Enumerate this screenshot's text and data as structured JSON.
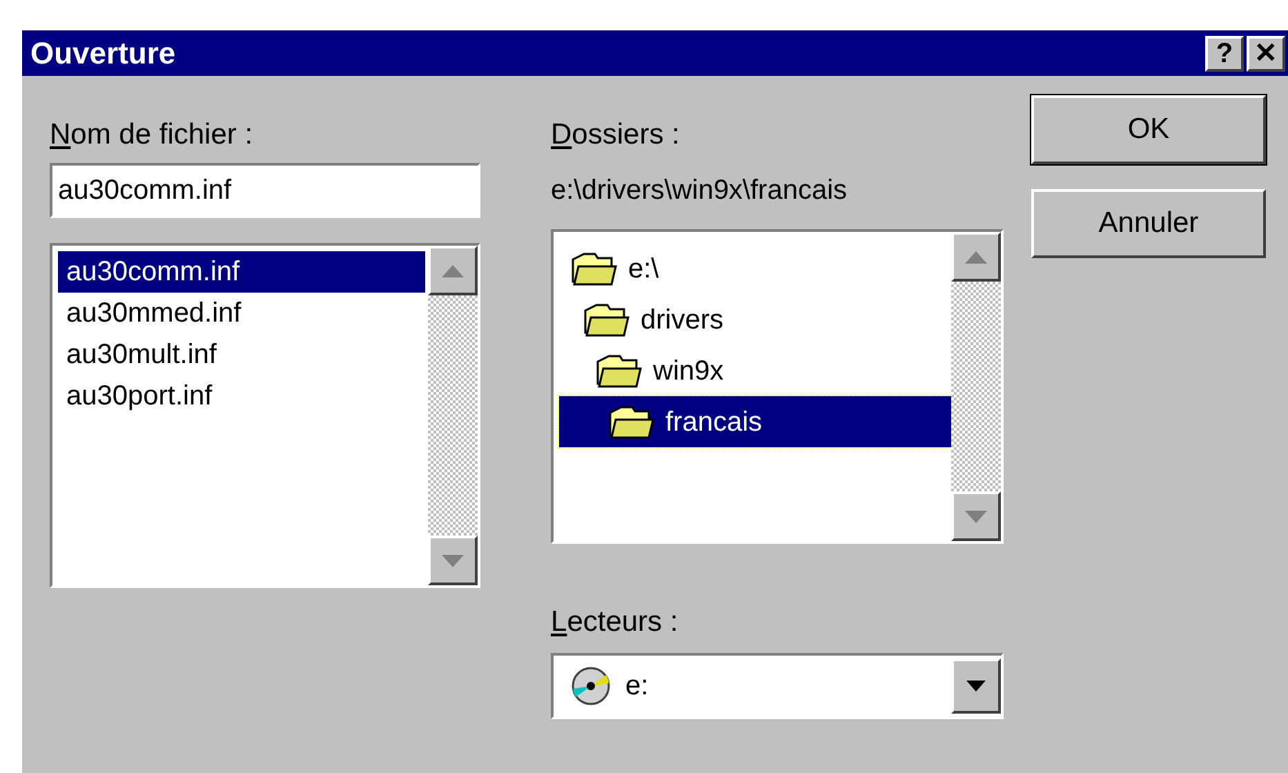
{
  "window": {
    "title": "Ouverture",
    "controls": [
      {
        "label": "?"
      },
      {
        "label": "✕"
      }
    ]
  },
  "file_name": {
    "label": "Nom de fichier :",
    "mnemonic": true,
    "value": "au30comm.inf"
  },
  "files": [
    {
      "name": "au30comm.inf",
      "selected": true
    },
    {
      "name": "au30mmed.inf",
      "selected": false
    },
    {
      "name": "au30mult.inf",
      "selected": false
    },
    {
      "name": "au30port.inf",
      "selected": false
    }
  ],
  "folders_label": {
    "label": "Dossiers :",
    "mnemonic": true
  },
  "current_path": "e:\\drivers\\win9x\\francais",
  "folders": [
    {
      "name": "e:\\",
      "selected": false,
      "children": [
        {
          "name": "drivers",
          "selected": false,
          "children": [
            {
              "name": "win9x",
              "selected": false,
              "children": [
                {
                  "name": "francais",
                  "selected": true
                }
              ]
            }
          ]
        }
      ]
    }
  ],
  "drives": {
    "label": "Lecteurs :",
    "mnemonic": true,
    "value": "e:"
  },
  "buttons": [
    {
      "label": "OK",
      "default": true
    },
    {
      "label": "Annuler",
      "default": false
    }
  ]
}
